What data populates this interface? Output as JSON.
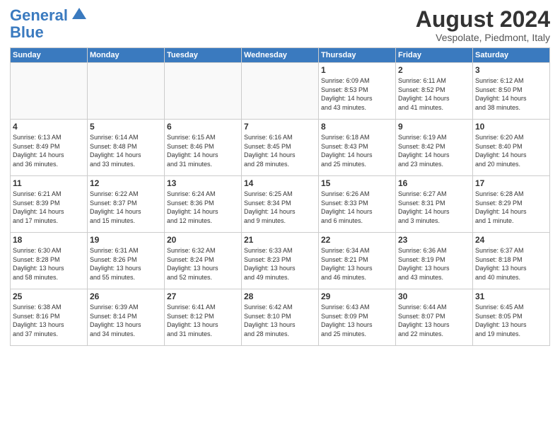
{
  "header": {
    "logo_line1": "General",
    "logo_line2": "Blue",
    "month_year": "August 2024",
    "location": "Vespolate, Piedmont, Italy"
  },
  "weekdays": [
    "Sunday",
    "Monday",
    "Tuesday",
    "Wednesday",
    "Thursday",
    "Friday",
    "Saturday"
  ],
  "weeks": [
    [
      {
        "day": "",
        "info": ""
      },
      {
        "day": "",
        "info": ""
      },
      {
        "day": "",
        "info": ""
      },
      {
        "day": "",
        "info": ""
      },
      {
        "day": "1",
        "info": "Sunrise: 6:09 AM\nSunset: 8:53 PM\nDaylight: 14 hours\nand 43 minutes."
      },
      {
        "day": "2",
        "info": "Sunrise: 6:11 AM\nSunset: 8:52 PM\nDaylight: 14 hours\nand 41 minutes."
      },
      {
        "day": "3",
        "info": "Sunrise: 6:12 AM\nSunset: 8:50 PM\nDaylight: 14 hours\nand 38 minutes."
      }
    ],
    [
      {
        "day": "4",
        "info": "Sunrise: 6:13 AM\nSunset: 8:49 PM\nDaylight: 14 hours\nand 36 minutes."
      },
      {
        "day": "5",
        "info": "Sunrise: 6:14 AM\nSunset: 8:48 PM\nDaylight: 14 hours\nand 33 minutes."
      },
      {
        "day": "6",
        "info": "Sunrise: 6:15 AM\nSunset: 8:46 PM\nDaylight: 14 hours\nand 31 minutes."
      },
      {
        "day": "7",
        "info": "Sunrise: 6:16 AM\nSunset: 8:45 PM\nDaylight: 14 hours\nand 28 minutes."
      },
      {
        "day": "8",
        "info": "Sunrise: 6:18 AM\nSunset: 8:43 PM\nDaylight: 14 hours\nand 25 minutes."
      },
      {
        "day": "9",
        "info": "Sunrise: 6:19 AM\nSunset: 8:42 PM\nDaylight: 14 hours\nand 23 minutes."
      },
      {
        "day": "10",
        "info": "Sunrise: 6:20 AM\nSunset: 8:40 PM\nDaylight: 14 hours\nand 20 minutes."
      }
    ],
    [
      {
        "day": "11",
        "info": "Sunrise: 6:21 AM\nSunset: 8:39 PM\nDaylight: 14 hours\nand 17 minutes."
      },
      {
        "day": "12",
        "info": "Sunrise: 6:22 AM\nSunset: 8:37 PM\nDaylight: 14 hours\nand 15 minutes."
      },
      {
        "day": "13",
        "info": "Sunrise: 6:24 AM\nSunset: 8:36 PM\nDaylight: 14 hours\nand 12 minutes."
      },
      {
        "day": "14",
        "info": "Sunrise: 6:25 AM\nSunset: 8:34 PM\nDaylight: 14 hours\nand 9 minutes."
      },
      {
        "day": "15",
        "info": "Sunrise: 6:26 AM\nSunset: 8:33 PM\nDaylight: 14 hours\nand 6 minutes."
      },
      {
        "day": "16",
        "info": "Sunrise: 6:27 AM\nSunset: 8:31 PM\nDaylight: 14 hours\nand 3 minutes."
      },
      {
        "day": "17",
        "info": "Sunrise: 6:28 AM\nSunset: 8:29 PM\nDaylight: 14 hours\nand 1 minute."
      }
    ],
    [
      {
        "day": "18",
        "info": "Sunrise: 6:30 AM\nSunset: 8:28 PM\nDaylight: 13 hours\nand 58 minutes."
      },
      {
        "day": "19",
        "info": "Sunrise: 6:31 AM\nSunset: 8:26 PM\nDaylight: 13 hours\nand 55 minutes."
      },
      {
        "day": "20",
        "info": "Sunrise: 6:32 AM\nSunset: 8:24 PM\nDaylight: 13 hours\nand 52 minutes."
      },
      {
        "day": "21",
        "info": "Sunrise: 6:33 AM\nSunset: 8:23 PM\nDaylight: 13 hours\nand 49 minutes."
      },
      {
        "day": "22",
        "info": "Sunrise: 6:34 AM\nSunset: 8:21 PM\nDaylight: 13 hours\nand 46 minutes."
      },
      {
        "day": "23",
        "info": "Sunrise: 6:36 AM\nSunset: 8:19 PM\nDaylight: 13 hours\nand 43 minutes."
      },
      {
        "day": "24",
        "info": "Sunrise: 6:37 AM\nSunset: 8:18 PM\nDaylight: 13 hours\nand 40 minutes."
      }
    ],
    [
      {
        "day": "25",
        "info": "Sunrise: 6:38 AM\nSunset: 8:16 PM\nDaylight: 13 hours\nand 37 minutes."
      },
      {
        "day": "26",
        "info": "Sunrise: 6:39 AM\nSunset: 8:14 PM\nDaylight: 13 hours\nand 34 minutes."
      },
      {
        "day": "27",
        "info": "Sunrise: 6:41 AM\nSunset: 8:12 PM\nDaylight: 13 hours\nand 31 minutes."
      },
      {
        "day": "28",
        "info": "Sunrise: 6:42 AM\nSunset: 8:10 PM\nDaylight: 13 hours\nand 28 minutes."
      },
      {
        "day": "29",
        "info": "Sunrise: 6:43 AM\nSunset: 8:09 PM\nDaylight: 13 hours\nand 25 minutes."
      },
      {
        "day": "30",
        "info": "Sunrise: 6:44 AM\nSunset: 8:07 PM\nDaylight: 13 hours\nand 22 minutes."
      },
      {
        "day": "31",
        "info": "Sunrise: 6:45 AM\nSunset: 8:05 PM\nDaylight: 13 hours\nand 19 minutes."
      }
    ]
  ]
}
